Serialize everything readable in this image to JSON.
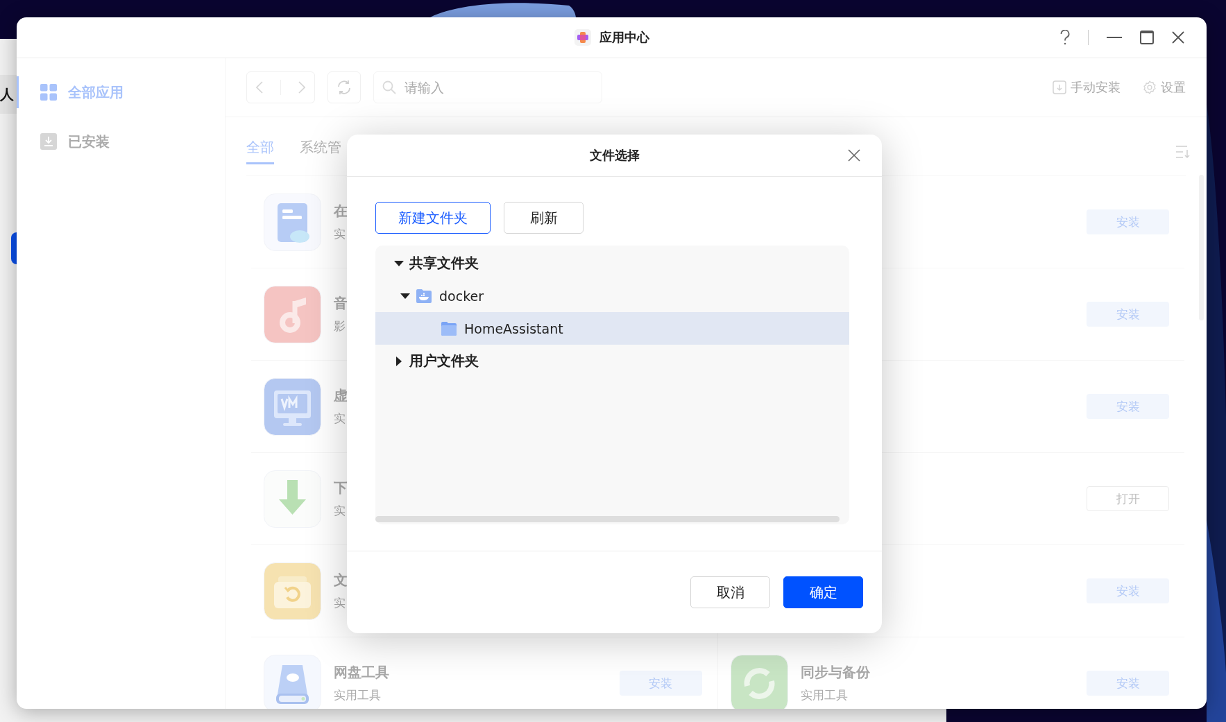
{
  "back_window": {
    "text": "人"
  },
  "window": {
    "title": "应用中心"
  },
  "sidebar": {
    "items": [
      {
        "label": "全部应用",
        "selected": true,
        "kind": "grid"
      },
      {
        "label": "已安装",
        "selected": false,
        "kind": "download"
      }
    ]
  },
  "toolbar": {
    "search": {
      "placeholder": "请输入"
    },
    "actions": [
      {
        "label": "手动安装",
        "kind": "install"
      },
      {
        "label": "设置",
        "kind": "settings"
      }
    ]
  },
  "tabs": [
    {
      "label": "全部",
      "selected": true
    },
    {
      "label": "系统管",
      "selected": false
    }
  ],
  "apps": [
    {
      "kind": "document-cloud",
      "name": "在",
      "category": "实"
    },
    {
      "button": {
        "label": "安装",
        "kind": "install"
      }
    },
    {
      "kind": "music",
      "name": "音",
      "category": "影"
    },
    {
      "button": {
        "label": "安装",
        "kind": "install"
      }
    },
    {
      "kind": "vm",
      "name": "虚",
      "category": "实"
    },
    {
      "button": {
        "label": "安装",
        "kind": "install"
      }
    },
    {
      "kind": "download",
      "name": "下",
      "category": "实"
    },
    {
      "button": {
        "label": "打开",
        "kind": "open"
      }
    },
    {
      "kind": "backup",
      "name": "文",
      "category": "实"
    },
    {
      "button": {
        "label": "安装",
        "kind": "install"
      }
    },
    {
      "kind": "drive",
      "name": "网盘工具",
      "category": "实用工具",
      "button": {
        "label": "安装",
        "kind": "install"
      }
    },
    {
      "kind": "sync",
      "name": "同步与备份",
      "category": "实用工具",
      "button": {
        "label": "安装",
        "kind": "install"
      }
    }
  ],
  "dialog": {
    "title": "文件选择",
    "toolbar_buttons": [
      {
        "label": "新建文件夹",
        "kind": "primary-outline"
      },
      {
        "label": "刷新",
        "kind": "default"
      }
    ],
    "tree": [
      {
        "label": "共享文件夹",
        "kind": "root",
        "expanded": true,
        "selected": false,
        "children": [
          {
            "label": "docker",
            "kind": "docker-folder",
            "expanded": true,
            "selected": false,
            "children": [
              {
                "label": "HomeAssistant",
                "kind": "folder",
                "selected": true
              }
            ]
          }
        ]
      },
      {
        "label": "用户文件夹",
        "kind": "root",
        "expanded": false,
        "selected": false
      }
    ],
    "footer_buttons": [
      {
        "label": "取消",
        "kind": "default"
      },
      {
        "label": "确定",
        "kind": "primary"
      }
    ]
  }
}
